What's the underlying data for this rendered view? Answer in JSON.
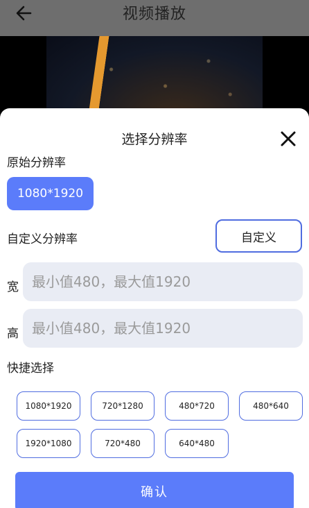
{
  "topbar": {
    "title": "视频播放",
    "back_icon": "arrow-left-icon"
  },
  "sheet": {
    "title": "选择分辨率",
    "close_icon": "close-icon",
    "original": {
      "label": "原始分辨率",
      "value": "1080*1920"
    },
    "custom": {
      "label": "自定义分辨率",
      "button": "自定义"
    },
    "width": {
      "label": "宽",
      "placeholder": "最小值480，最大值1920",
      "value": ""
    },
    "height": {
      "label": "高",
      "placeholder": "最小值480，最大值1920",
      "value": ""
    },
    "quick": {
      "label": "快捷选择",
      "options": [
        "1080*1920",
        "720*1280",
        "480*720",
        "480*640",
        "1920*1080",
        "720*480",
        "640*480"
      ]
    },
    "confirm": "确认"
  },
  "colors": {
    "accent": "#5b7cfa",
    "border": "#4f6ce0",
    "input_bg": "#e9ecf4",
    "topbar": "#6e6e6e"
  }
}
